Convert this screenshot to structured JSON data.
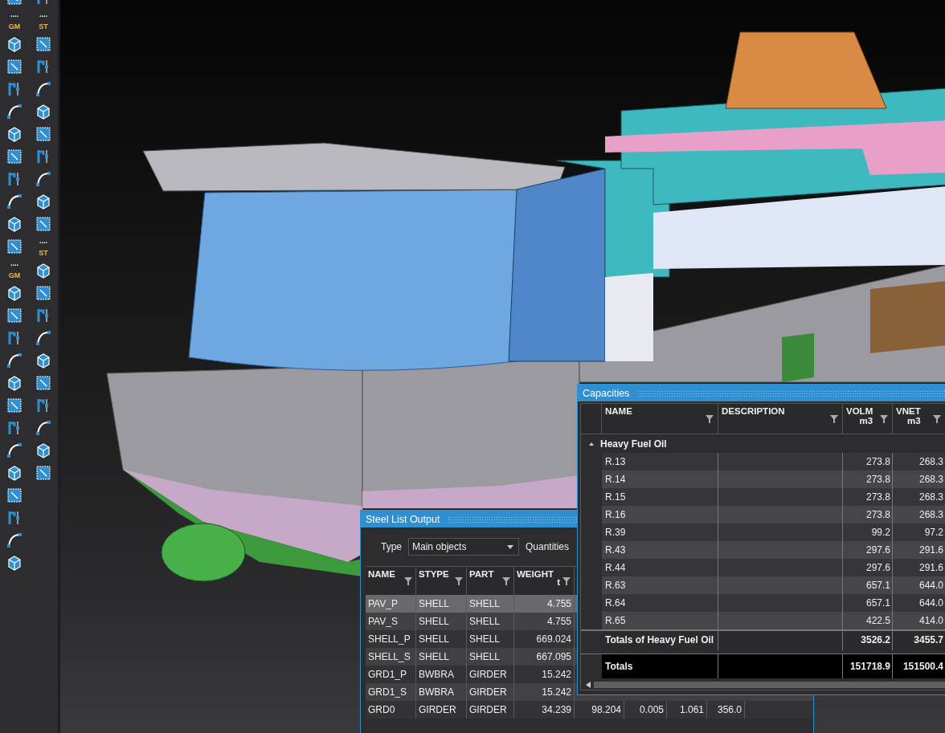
{
  "toolbar": {
    "columns": [
      {
        "items": [
          {
            "kind": "tool"
          },
          {
            "kind": "dots",
            "text": "...."
          },
          {
            "kind": "label",
            "text": "GM"
          },
          {
            "kind": "tool"
          },
          {
            "kind": "tool"
          },
          {
            "kind": "tool"
          },
          {
            "kind": "tool"
          },
          {
            "kind": "tool"
          },
          {
            "kind": "tool"
          },
          {
            "kind": "tool"
          },
          {
            "kind": "tool"
          },
          {
            "kind": "tool"
          },
          {
            "kind": "tool"
          },
          {
            "kind": "dots",
            "text": "...."
          },
          {
            "kind": "label",
            "text": "GM"
          },
          {
            "kind": "tool"
          },
          {
            "kind": "tool"
          },
          {
            "kind": "tool"
          },
          {
            "kind": "tool"
          },
          {
            "kind": "tool"
          },
          {
            "kind": "tool"
          },
          {
            "kind": "tool"
          },
          {
            "kind": "tool"
          },
          {
            "kind": "tool"
          },
          {
            "kind": "tool"
          },
          {
            "kind": "tool"
          },
          {
            "kind": "tool"
          },
          {
            "kind": "tool"
          }
        ]
      },
      {
        "items": [
          {
            "kind": "tool"
          },
          {
            "kind": "dots",
            "text": "...."
          },
          {
            "kind": "label",
            "text": "ST"
          },
          {
            "kind": "tool"
          },
          {
            "kind": "tool"
          },
          {
            "kind": "tool"
          },
          {
            "kind": "tool"
          },
          {
            "kind": "tool"
          },
          {
            "kind": "tool"
          },
          {
            "kind": "tool"
          },
          {
            "kind": "tool"
          },
          {
            "kind": "tool"
          },
          {
            "kind": "dots",
            "text": "...."
          },
          {
            "kind": "label",
            "text": "ST"
          },
          {
            "kind": "tool"
          },
          {
            "kind": "tool"
          },
          {
            "kind": "tool"
          },
          {
            "kind": "tool"
          },
          {
            "kind": "tool"
          },
          {
            "kind": "tool"
          },
          {
            "kind": "tool"
          },
          {
            "kind": "tool"
          },
          {
            "kind": "tool"
          },
          {
            "kind": "tool"
          }
        ]
      }
    ]
  },
  "steel_list": {
    "title": "Steel List Output",
    "type_label": "Type",
    "type_value": "Main objects",
    "quantities_label": "Quantities",
    "columns": [
      {
        "label": "NAME"
      },
      {
        "label": "STYPE"
      },
      {
        "label": "PART"
      },
      {
        "label": "WEIGHT",
        "unit": "t"
      }
    ],
    "rows": [
      {
        "cells": [
          "PAV_P",
          "SHELL",
          "SHELL",
          "4.755"
        ],
        "selected": true
      },
      {
        "cells": [
          "PAV_S",
          "SHELL",
          "SHELL",
          "4.755"
        ],
        "selected": false
      },
      {
        "cells": [
          "SHELL_P",
          "SHELL",
          "SHELL",
          "669.024"
        ],
        "selected": false
      },
      {
        "cells": [
          "SHELL_S",
          "SHELL",
          "SHELL",
          "667.095"
        ],
        "selected": false
      },
      {
        "cells": [
          "GRD1_P",
          "BWBRA",
          "GIRDER",
          "15.242"
        ],
        "selected": false
      },
      {
        "cells": [
          "GRD1_S",
          "BWBRA",
          "GIRDER",
          "15.242"
        ],
        "selected": false
      },
      {
        "cells": [
          "GRD0",
          "GIRDER",
          "GIRDER",
          "34.239",
          "98.204",
          "0.005",
          "1.061",
          "356.0"
        ],
        "selected": false
      }
    ]
  },
  "capacities": {
    "title": "Capacities",
    "columns": [
      {
        "label": "NAME"
      },
      {
        "label": "DESCRIPTION"
      },
      {
        "label": "VOLM",
        "unit": "m3"
      },
      {
        "label": "VNET",
        "unit": "m3"
      }
    ],
    "groups": [
      {
        "name": "Heavy Fuel Oil",
        "expanded": true,
        "rows": [
          {
            "name": "R.13",
            "volm": "273.8",
            "vnet": "268.3"
          },
          {
            "name": "R.14",
            "volm": "273.8",
            "vnet": "268.3"
          },
          {
            "name": "R.15",
            "volm": "273.8",
            "vnet": "268.3"
          },
          {
            "name": "R.16",
            "volm": "273.8",
            "vnet": "268.3"
          },
          {
            "name": "R.39",
            "volm": "99.2",
            "vnet": "97.2"
          },
          {
            "name": "R.43",
            "volm": "297.6",
            "vnet": "291.6"
          },
          {
            "name": "R.44",
            "volm": "297.6",
            "vnet": "291.6"
          },
          {
            "name": "R.63",
            "volm": "657.1",
            "vnet": "644.0"
          },
          {
            "name": "R.64",
            "volm": "657.1",
            "vnet": "644.0"
          },
          {
            "name": "R.65",
            "volm": "422.5",
            "vnet": "414.0"
          }
        ],
        "subtotal": {
          "name": "Totals of Heavy Fuel Oil",
          "volm": "3526.2",
          "vnet": "3455.7"
        }
      }
    ],
    "totals": {
      "name": "Totals",
      "volm": "151718.9",
      "vnet": "151500.4"
    }
  }
}
